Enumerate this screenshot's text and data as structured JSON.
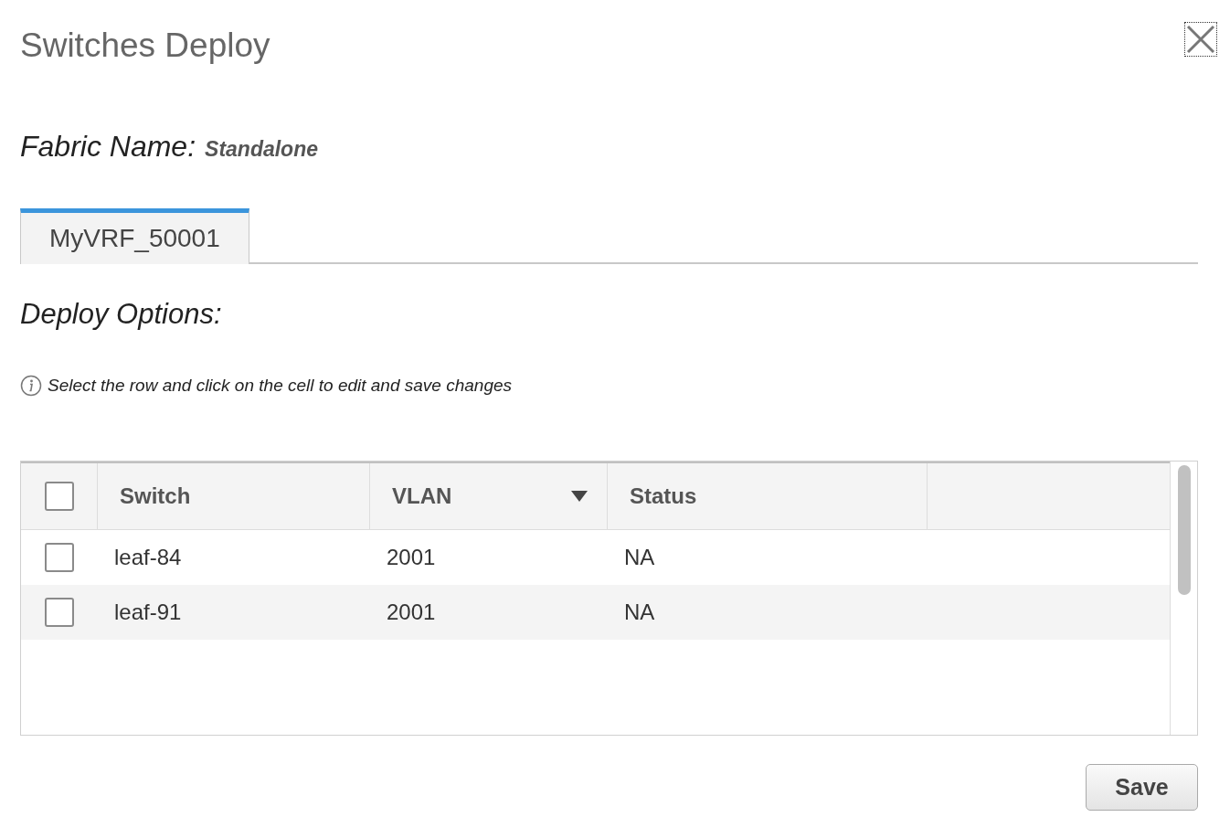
{
  "dialog": {
    "title": "Switches Deploy"
  },
  "fabric": {
    "label": "Fabric Name:",
    "value": "Standalone"
  },
  "tabs": [
    {
      "label": "MyVRF_50001",
      "selected": true
    }
  ],
  "deploy_options": {
    "heading": "Deploy Options:",
    "hint": "Select the row and click on the cell to edit and save changes"
  },
  "table": {
    "select_all_checked": false,
    "columns": [
      {
        "label": "Switch",
        "sorted": false
      },
      {
        "label": "VLAN",
        "sorted": true
      },
      {
        "label": "Status",
        "sorted": false
      }
    ],
    "rows": [
      {
        "checked": false,
        "cells": [
          "leaf-84",
          "2001",
          "NA"
        ]
      },
      {
        "checked": false,
        "cells": [
          "leaf-91",
          "2001",
          "NA"
        ]
      }
    ]
  },
  "buttons": [
    {
      "label": "Save"
    }
  ]
}
